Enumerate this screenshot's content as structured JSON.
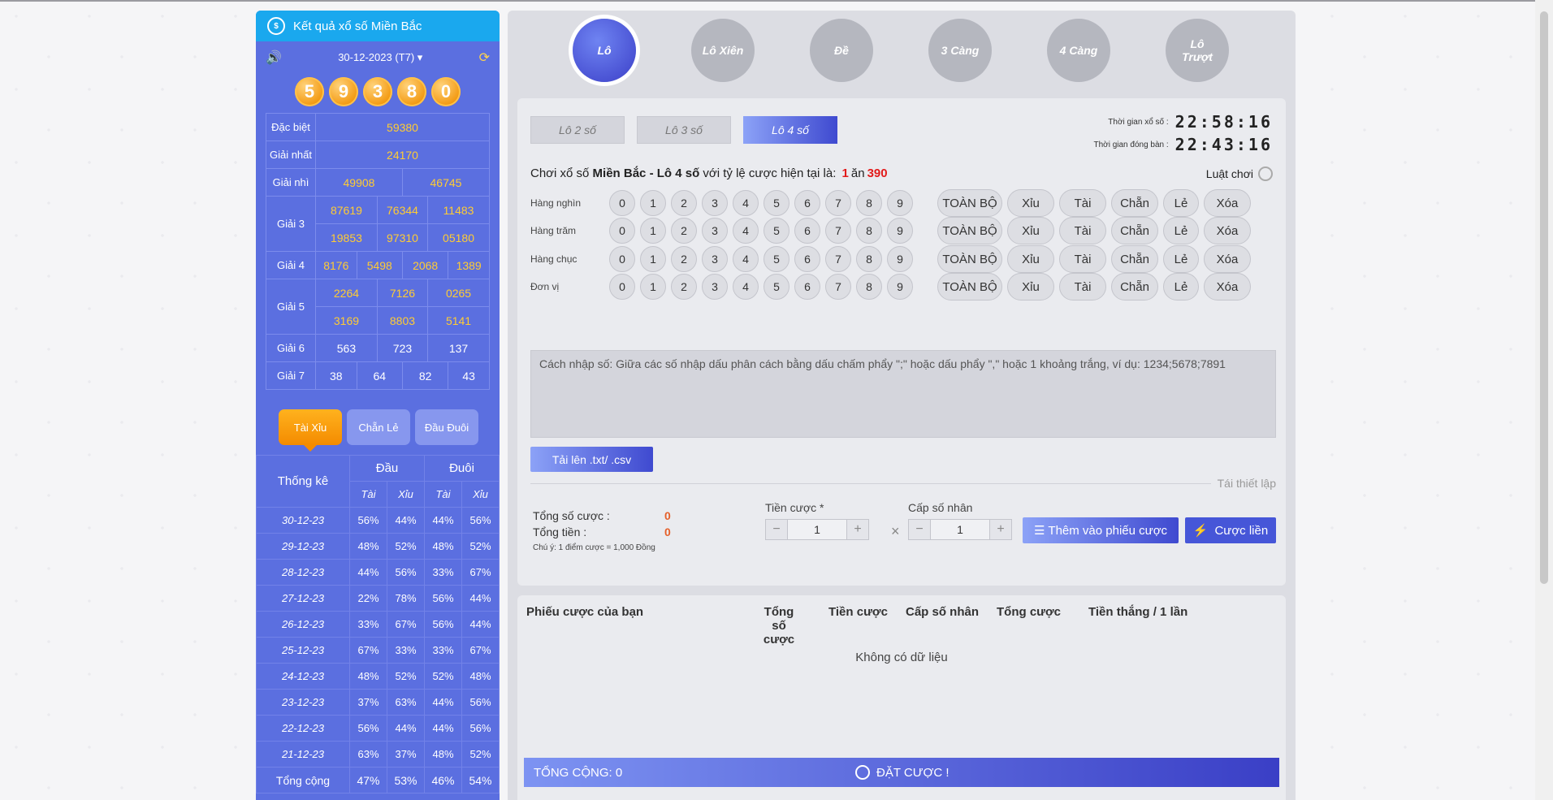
{
  "left_panel": {
    "title": "Kết quả xổ số Miền Bắc",
    "date": "30-12-2023 (T7)",
    "balls": [
      "5",
      "9",
      "3",
      "8",
      "0"
    ],
    "results": {
      "special_label": "Đặc biệt",
      "special": "59380",
      "first_label": "Giải nhất",
      "first": "24170",
      "second_label": "Giải nhì",
      "second": [
        "49908",
        "46745"
      ],
      "third_label": "Giải 3",
      "third": [
        "87619",
        "76344",
        "11483",
        "19853",
        "97310",
        "05180"
      ],
      "fourth_label": "Giải 4",
      "fourth": [
        "8176",
        "5498",
        "2068",
        "1389"
      ],
      "fifth_label": "Giải 5",
      "fifth": [
        "2264",
        "7126",
        "0265",
        "3169",
        "8803",
        "5141"
      ],
      "sixth_label": "Giải 6",
      "sixth": [
        "563",
        "723",
        "137"
      ],
      "seventh_label": "Giải 7",
      "seventh": [
        "38",
        "64",
        "82",
        "43"
      ]
    },
    "tabs": [
      "Tài Xỉu",
      "Chẵn Lẻ",
      "Đầu Đuôi"
    ],
    "stats": {
      "label": "Thống kê",
      "head": "Đầu",
      "tail": "Đuôi",
      "tai": "Tài",
      "xiu": "Xỉu",
      "rows": [
        [
          "30-12-23",
          "56%",
          "44%",
          "44%",
          "56%"
        ],
        [
          "29-12-23",
          "48%",
          "52%",
          "48%",
          "52%"
        ],
        [
          "28-12-23",
          "44%",
          "56%",
          "33%",
          "67%"
        ],
        [
          "27-12-23",
          "22%",
          "78%",
          "56%",
          "44%"
        ],
        [
          "26-12-23",
          "33%",
          "67%",
          "56%",
          "44%"
        ],
        [
          "25-12-23",
          "67%",
          "33%",
          "33%",
          "67%"
        ],
        [
          "24-12-23",
          "48%",
          "52%",
          "52%",
          "48%"
        ],
        [
          "23-12-23",
          "37%",
          "63%",
          "44%",
          "56%"
        ],
        [
          "22-12-23",
          "56%",
          "44%",
          "44%",
          "56%"
        ],
        [
          "21-12-23",
          "63%",
          "37%",
          "48%",
          "52%"
        ]
      ],
      "total": [
        "Tổng cộng",
        "47%",
        "53%",
        "46%",
        "54%"
      ]
    }
  },
  "game_types": [
    "Lô",
    "Lô Xiên",
    "Đề",
    "3 Càng",
    "4 Càng",
    "Lô Trượt"
  ],
  "subtabs": [
    "Lô 2 số",
    "Lô 3 số",
    "Lô 4 số"
  ],
  "timers": {
    "draw_label": "Thời gian xổ số :",
    "draw_value": "22:58:16",
    "close_label": "Thời gian đóng bàn :",
    "close_value": "22:43:16"
  },
  "play": {
    "prefix": "Chơi xổ số",
    "game": "Miền Bắc - Lô 4 số",
    "middle": "với tỷ lệ cược hiện tại là:",
    "ratio_a": "1",
    "ratio_word": "ăn",
    "ratio_b": "390",
    "rules": "Luật chơi"
  },
  "digit_rows": [
    "Hàng nghìn",
    "Hàng trăm",
    "Hàng chục",
    "Đơn vị"
  ],
  "digits": [
    "0",
    "1",
    "2",
    "3",
    "4",
    "5",
    "6",
    "7",
    "8",
    "9"
  ],
  "quick": [
    "TOÀN BỘ",
    "Xỉu",
    "Tài",
    "Chẵn",
    "Lẻ",
    "Xóa"
  ],
  "input_hint": "Cách nhập số: Giữa các số nhập dấu phân cách bằng dấu chấm phẩy \";\" hoặc dấu phẩy \",\" hoặc 1 khoảng trắng, ví dụ: 1234;5678;7891",
  "upload_label": "Tải lên .txt/ .csv",
  "reset_label": "Tái thiết lập",
  "summary": {
    "count_label": "Tổng số cược :",
    "count": "0",
    "money_label": "Tổng tiền :",
    "money": "0",
    "note": "Chú ý: 1 điểm cược = 1,000 Đồng"
  },
  "bet_amount": {
    "label": "Tiền cược *",
    "value": "1"
  },
  "multiplier": {
    "label": "Cấp số nhân",
    "value": "1"
  },
  "add_button": "Thêm vào phiếu cược",
  "bet_now": "Cược liền",
  "ticket_table": {
    "cols": [
      "Phiếu cược của bạn",
      "Tổng số cược",
      "Tiền cược",
      "Cấp số nhân",
      "Tổng cược",
      "Tiền thắng / 1 lần"
    ],
    "empty": "Không có dữ liệu"
  },
  "footer": {
    "total": "TỔNG CỘNG: 0",
    "place_bet": "ĐẶT CƯỢC !"
  }
}
